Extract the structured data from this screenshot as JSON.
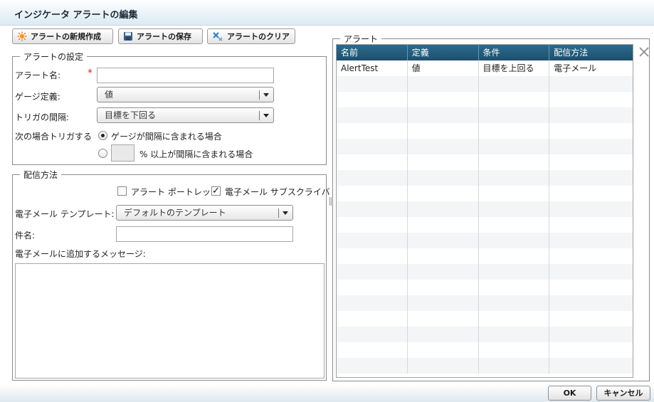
{
  "window": {
    "title": "インジケータ アラートの編集"
  },
  "toolbar": {
    "new_label": "アラートの新規作成",
    "save_label": "アラートの保存",
    "clear_label": "アラートのクリア"
  },
  "settings": {
    "legend": "アラートの設定",
    "name_label": "アラート名:",
    "name_value": "",
    "gauge_label": "ゲージ定義:",
    "gauge_value": "値",
    "trigger_interval_label": "トリガの間隔:",
    "trigger_interval_value": "目標を下回る",
    "trigger_when_label": "次の場合トリガする",
    "option_within": "ゲージが間隔に含まれる場合",
    "option_percent_suffix": "% 以上が間隔に含まれる場合",
    "percent_value": ""
  },
  "delivery": {
    "legend": "配信方法",
    "portlet_label": "アラート ポートレット",
    "email_label": "電子メール サブスクライバ",
    "template_label": "電子メール テンプレート:",
    "template_value": "デフォルトのテンプレート",
    "subject_label": "件名:",
    "subject_value": "",
    "message_label": "電子メールに追加するメッセージ:",
    "message_value": ""
  },
  "alerts": {
    "legend": "アラート",
    "columns": [
      "名前",
      "定義",
      "条件",
      "配信方法"
    ],
    "rows": [
      [
        "AlertTest",
        "値",
        "目標を上回る",
        "電子メール"
      ]
    ],
    "empty_rows": 19
  },
  "footer": {
    "ok_label": "OK",
    "cancel_label": "キャンセル"
  },
  "colors": {
    "grid_header": "#23597a",
    "required": "#e0261f"
  }
}
